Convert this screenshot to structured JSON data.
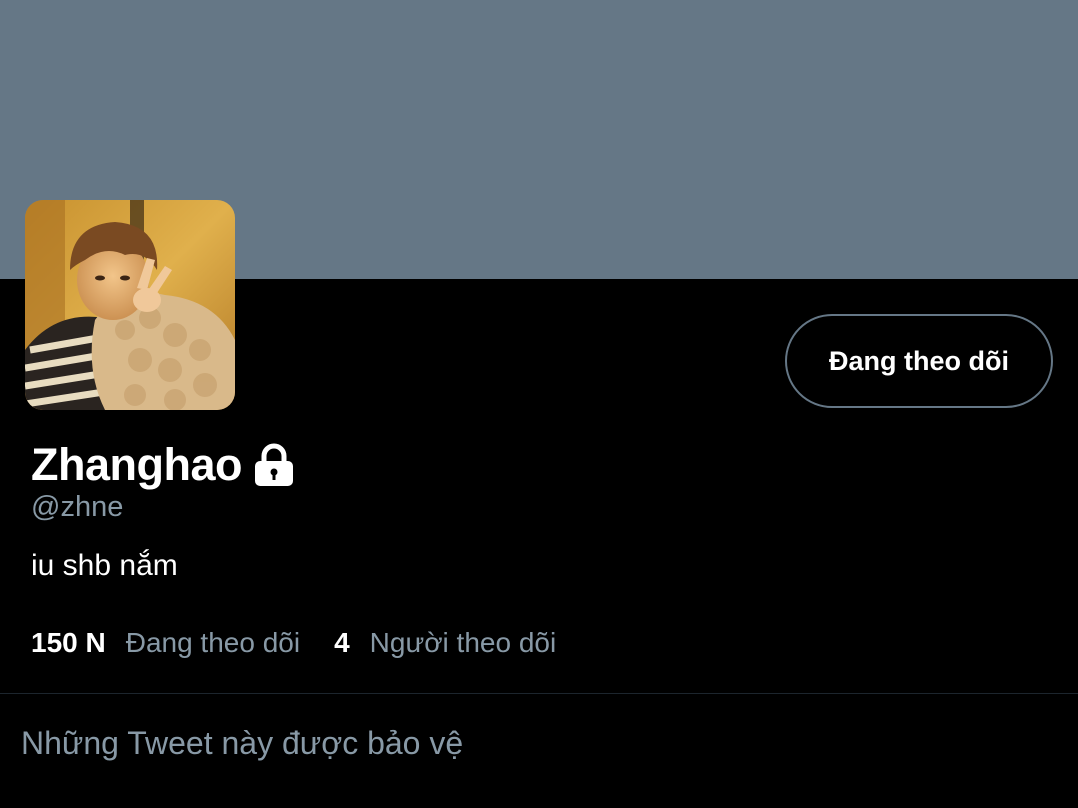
{
  "colors": {
    "banner": "#657786",
    "background": "#000000",
    "secondary_text": "#8899a6",
    "primary_text": "#ffffff"
  },
  "profile": {
    "display_name": "Zhanghao",
    "handle": "@zhne",
    "bio": "iu shb nắm",
    "protected_icon": "lock-icon",
    "avatar_icon": "profile-photo"
  },
  "follow_button": {
    "label": "Đang theo dõi"
  },
  "stats": {
    "following": {
      "count": "150 N",
      "label": "Đang theo dõi"
    },
    "followers": {
      "count": "4",
      "label": "Người theo dõi"
    }
  },
  "timeline": {
    "protected_message": "Những Tweet này được bảo vệ"
  }
}
